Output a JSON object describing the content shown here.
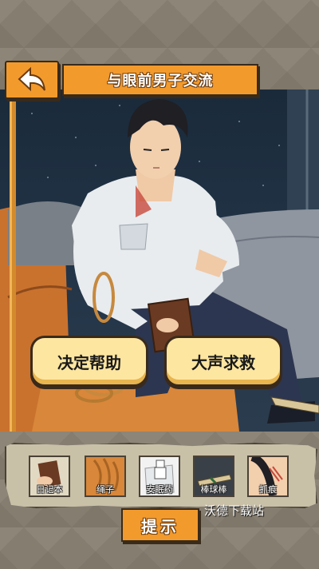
{
  "header": {
    "back_icon": "back-arrow-icon",
    "title": "与眼前男子交流"
  },
  "choices": [
    {
      "label": "决定帮助"
    },
    {
      "label": "大声求救"
    }
  ],
  "inventory": {
    "items": [
      {
        "label": "日记本",
        "icon": "notebook-icon"
      },
      {
        "label": "绳子",
        "icon": "rope-icon"
      },
      {
        "label": "安眠药",
        "icon": "pill-bottle-icon"
      },
      {
        "label": "棒球棒",
        "icon": "baseball-bat-icon"
      },
      {
        "label": "抓痕",
        "icon": "scratch-icon"
      }
    ]
  },
  "hint": {
    "label": "提示"
  },
  "watermark": "沃德下载站",
  "colors": {
    "accent_orange": "#f39a2d",
    "button_cream": "#fde6a0",
    "outline": "#3a2a1a"
  }
}
